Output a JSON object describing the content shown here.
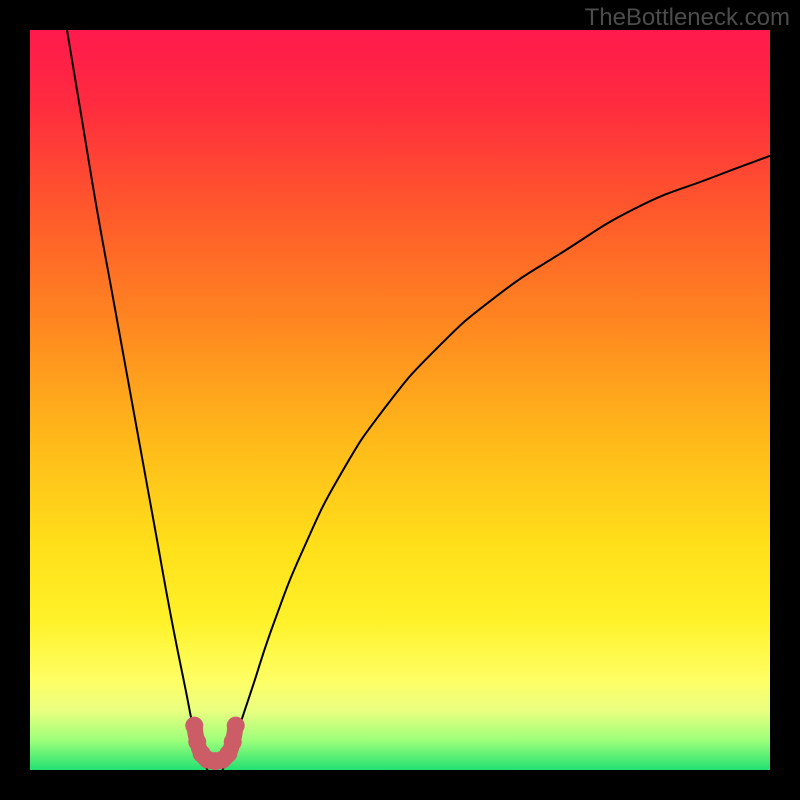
{
  "watermark": "TheBottleneck.com",
  "colors": {
    "gradient_stops": [
      {
        "offset": 0.0,
        "color": "#ff1a4d"
      },
      {
        "offset": 0.1,
        "color": "#ff2b3f"
      },
      {
        "offset": 0.25,
        "color": "#ff5a2b"
      },
      {
        "offset": 0.4,
        "color": "#ff8820"
      },
      {
        "offset": 0.55,
        "color": "#ffb81a"
      },
      {
        "offset": 0.7,
        "color": "#ffe01a"
      },
      {
        "offset": 0.8,
        "color": "#fff22a"
      },
      {
        "offset": 0.88,
        "color": "#ffff66"
      },
      {
        "offset": 0.92,
        "color": "#e9ff80"
      },
      {
        "offset": 0.96,
        "color": "#9dff7a"
      },
      {
        "offset": 1.0,
        "color": "#22e072"
      }
    ],
    "curve": "#000000",
    "dots": "#cc5d66",
    "background": "#000000"
  },
  "chart_data": {
    "type": "line",
    "title": "",
    "xlabel": "",
    "ylabel": "",
    "xlim": [
      0,
      100
    ],
    "ylim": [
      0,
      100
    ],
    "series": [
      {
        "name": "bottleneck-curve-left",
        "x": [
          5,
          7,
          9,
          11,
          13,
          15,
          17,
          19,
          21,
          22,
          23,
          24
        ],
        "values": [
          100,
          88,
          76,
          65,
          54,
          43,
          32,
          21,
          11,
          6,
          2,
          0
        ]
      },
      {
        "name": "bottleneck-curve-right",
        "x": [
          26,
          27,
          28,
          30,
          33,
          37,
          42,
          48,
          55,
          63,
          72,
          82,
          92,
          100
        ],
        "values": [
          0,
          2,
          5,
          11,
          20,
          30,
          40,
          49,
          57,
          64,
          70,
          76,
          80,
          83
        ]
      }
    ],
    "annotations": [
      {
        "name": "minimum-marker-dots",
        "x": [
          22.2,
          22.6,
          23.2,
          24.0,
          25.0,
          26.0,
          26.8,
          27.4,
          27.8
        ],
        "values": [
          6.0,
          3.8,
          2.2,
          1.4,
          1.2,
          1.4,
          2.2,
          3.8,
          6.0
        ]
      }
    ]
  }
}
